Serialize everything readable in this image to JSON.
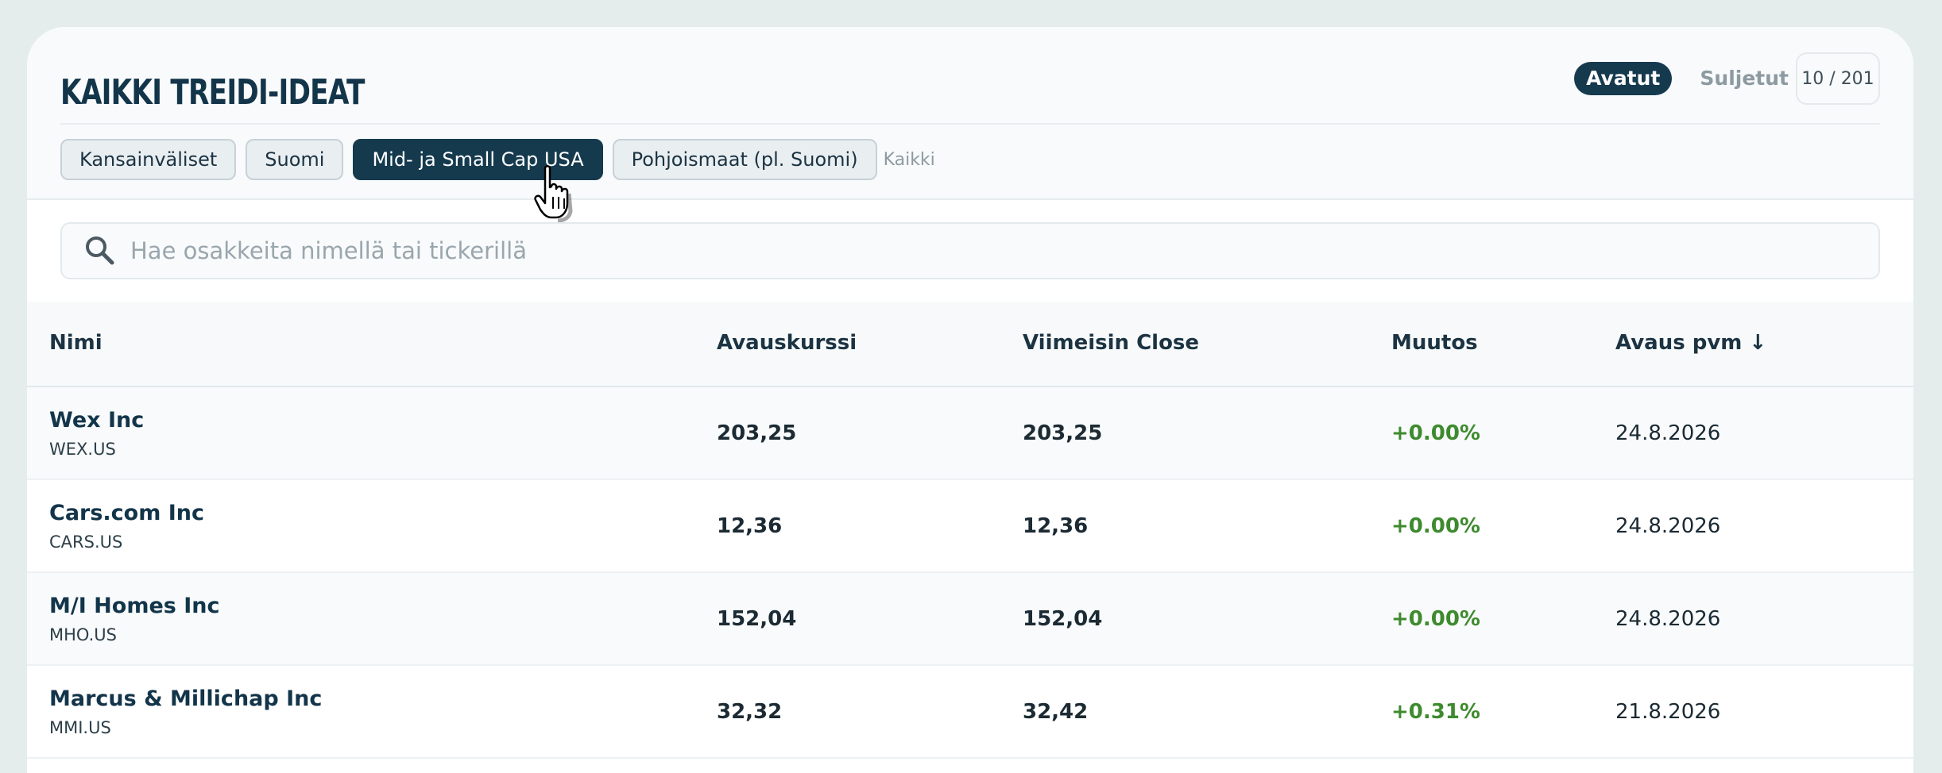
{
  "header": {
    "title": "KAIKKI TREIDI-IDEAT",
    "status_tabs": {
      "open": "Avatut",
      "closed": "Suljetut"
    },
    "counter": "10 / 201"
  },
  "category_tabs": [
    {
      "label": "Kansainväliset",
      "active": false
    },
    {
      "label": "Suomi",
      "active": false
    },
    {
      "label": "Mid- ja Small Cap USA",
      "active": true
    },
    {
      "label": "Pohjoismaat (pl. Suomi)",
      "active": false
    }
  ],
  "all_link": "Kaikki",
  "search": {
    "placeholder": "Hae osakkeita nimellä tai tickerillä",
    "value": ""
  },
  "table": {
    "columns": {
      "name": "Nimi",
      "open_price": "Avauskurssi",
      "last_close": "Viimeisin Close",
      "change": "Muutos",
      "open_date": "Avaus pvm ↓"
    },
    "rows": [
      {
        "name": "Wex Inc",
        "ticker": "WEX.US",
        "open_price": "203,25",
        "last_close": "203,25",
        "change": "+0.00%",
        "open_date": "24.8.2026"
      },
      {
        "name": "Cars.com Inc",
        "ticker": "CARS.US",
        "open_price": "12,36",
        "last_close": "12,36",
        "change": "+0.00%",
        "open_date": "24.8.2026"
      },
      {
        "name": "M/I Homes Inc",
        "ticker": "MHO.US",
        "open_price": "152,04",
        "last_close": "152,04",
        "change": "+0.00%",
        "open_date": "24.8.2026"
      },
      {
        "name": "Marcus & Millichap Inc",
        "ticker": "MMI.US",
        "open_price": "32,32",
        "last_close": "32,42",
        "change": "+0.31%",
        "open_date": "21.8.2026"
      }
    ]
  },
  "colors": {
    "brand": "#153a4e",
    "positive": "#3e8a2e",
    "background": "#e4ecec"
  }
}
